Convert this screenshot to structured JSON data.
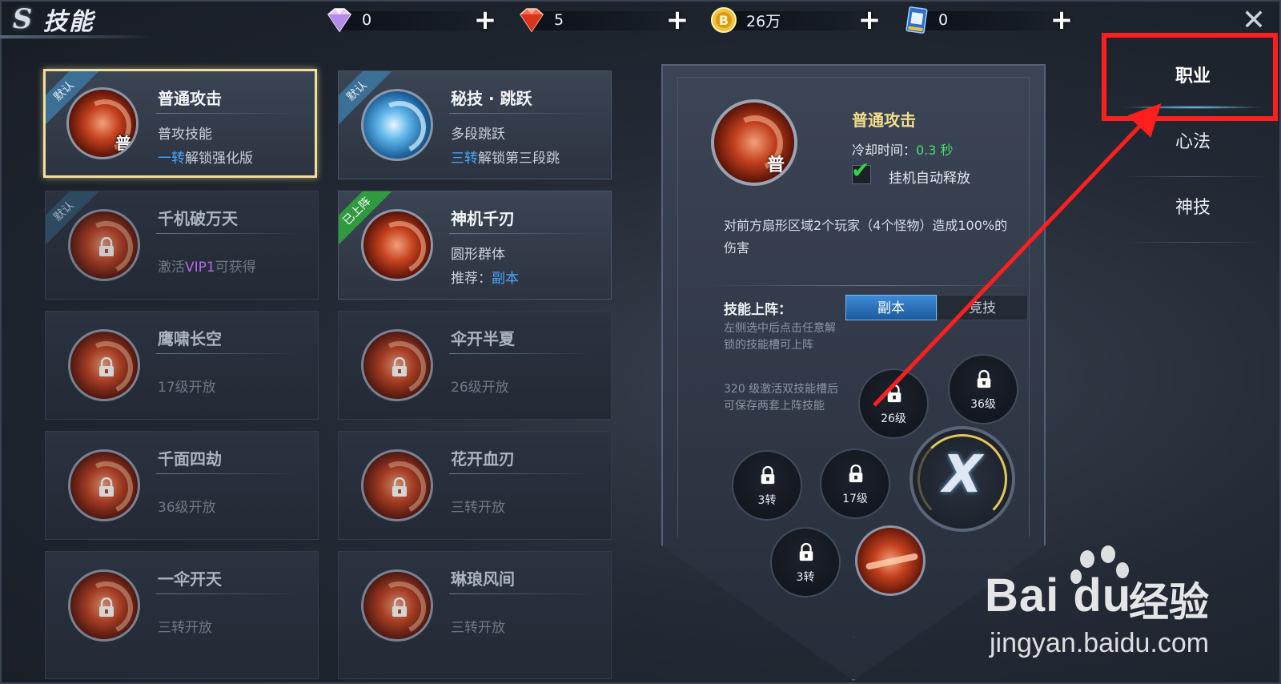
{
  "header": {
    "logo_glyph": "S",
    "title": "技能",
    "close_glyph": "✕"
  },
  "currencies": [
    {
      "icon": "diamond-icon",
      "value": "0"
    },
    {
      "icon": "ruby-icon",
      "value": "5"
    },
    {
      "icon": "gold-coin-icon",
      "value": "26万"
    },
    {
      "icon": "ticket-card-icon",
      "value": "0"
    }
  ],
  "skills": [
    {
      "name": "普通攻击",
      "ribbon": "默认",
      "line1": "普攻技能",
      "line2_hl": "一转",
      "line2_rest": "解锁强化版",
      "glyph": "普"
    },
    {
      "name": "秘技 · 跳跃",
      "ribbon": "默认",
      "line1": "多段跳跃",
      "line2_hl": "三转",
      "line2_rest": "解锁第三段跳"
    },
    {
      "name": "千机破万天",
      "ribbon": "默认",
      "line1_pre": "激活",
      "line1_hl": "VIP1",
      "line1_post": "可获得"
    },
    {
      "name": "神机千刃",
      "ribbon": "已上阵",
      "line1": "圆形群体",
      "line2_pre": "推荐：",
      "line2_hl": "副本"
    },
    {
      "name": "鹰啸长空",
      "line1": "17级开放"
    },
    {
      "name": "伞开半夏",
      "line1": "26级开放"
    },
    {
      "name": "千面四劫",
      "line1": "36级开放"
    },
    {
      "name": "花开血刃",
      "line1": "三转开放"
    },
    {
      "name": "一伞开天",
      "line1": "三转开放"
    },
    {
      "name": "琳琅风间",
      "line1": "三转开放"
    }
  ],
  "detail": {
    "name": "普通攻击",
    "glyph": "普",
    "cooldown_label": "冷却时间：",
    "cooldown_value": "0.3 秒",
    "check_mark": "✔",
    "auto_release": "挂机自动释放",
    "description": "对前方扇形区域2个玩家（4个怪物）造成100%的伤害",
    "deploy_label": "技能上阵：",
    "tabs": [
      "副本",
      "竞技"
    ],
    "hint1": "左侧选中后点击任意解锁的技能槽可上阵",
    "hint2": "320 级激活双技能槽后可保存两套上阵技能",
    "slots": [
      "26级",
      "36级",
      "3转",
      "17级",
      "3转"
    ],
    "attack_glyph": "X"
  },
  "nav": [
    "职业",
    "心法",
    "神技"
  ],
  "watermark": {
    "brand": "Bai du",
    "cn": "经验",
    "url": "jingyan.baidu.com"
  },
  "colors": {
    "accent_blue": "#49a6ff",
    "vip_purple": "#b56ae6",
    "cooldown_green": "#45e06a",
    "title_gold": "#f4de8a",
    "selected_border": "#f1df9e",
    "annotation_red": "#ff1f1f"
  }
}
